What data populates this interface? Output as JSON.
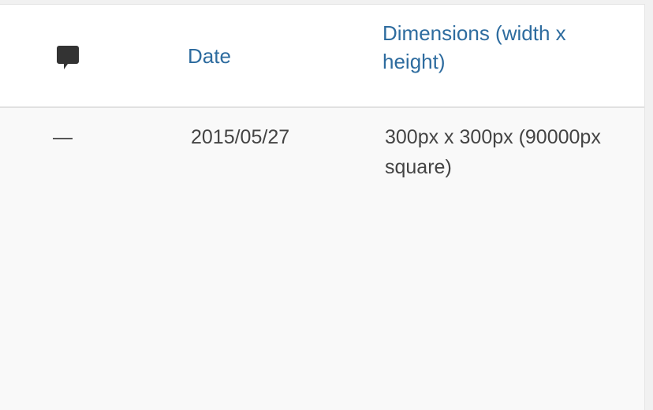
{
  "table": {
    "columns": {
      "comments_icon": "comment-bubble-icon",
      "date_label": "Date",
      "dimensions_label": "Dimensions (width x height)"
    },
    "rows": [
      {
        "comments": "—",
        "date": "2015/05/27",
        "dimensions": "300px x 300px (90000px square)"
      }
    ]
  },
  "colors": {
    "link": "#2e6c9f",
    "text": "#444444",
    "header_bg": "#ffffff",
    "row_bg": "#f9f9f9"
  }
}
